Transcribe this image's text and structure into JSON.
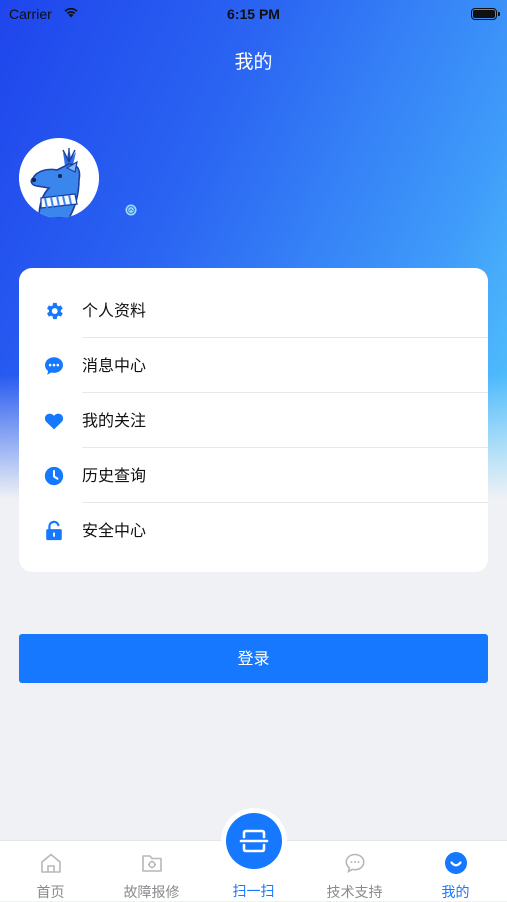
{
  "status_bar": {
    "carrier": "Carrier",
    "time": "6:15 PM"
  },
  "header": {
    "title": "我的"
  },
  "profile": {
    "avatar_icon": "deer-mascot-icon",
    "gender_icon": "gender-icon"
  },
  "menu": {
    "items": [
      {
        "label": "个人资料",
        "icon": "gear-icon"
      },
      {
        "label": "消息中心",
        "icon": "chat-bubble-icon"
      },
      {
        "label": "我的关注",
        "icon": "heart-icon"
      },
      {
        "label": "历史查询",
        "icon": "clock-icon"
      },
      {
        "label": "安全中心",
        "icon": "lock-icon"
      }
    ]
  },
  "login_button": {
    "label": "登录"
  },
  "tabbar": {
    "tabs": [
      {
        "label": "首页",
        "icon": "home-icon"
      },
      {
        "label": "故障报修",
        "icon": "repair-folder-icon"
      },
      {
        "label": "扫一扫",
        "icon": "scan-icon"
      },
      {
        "label": "技术支持",
        "icon": "support-chat-icon"
      },
      {
        "label": "我的",
        "icon": "profile-smile-icon"
      }
    ],
    "active": "我的"
  },
  "colors": {
    "accent": "#1677ff",
    "gradient_start": "#1f45ec",
    "gradient_end": "#56cdfd",
    "inactive_tab": "#8a8a8e"
  }
}
